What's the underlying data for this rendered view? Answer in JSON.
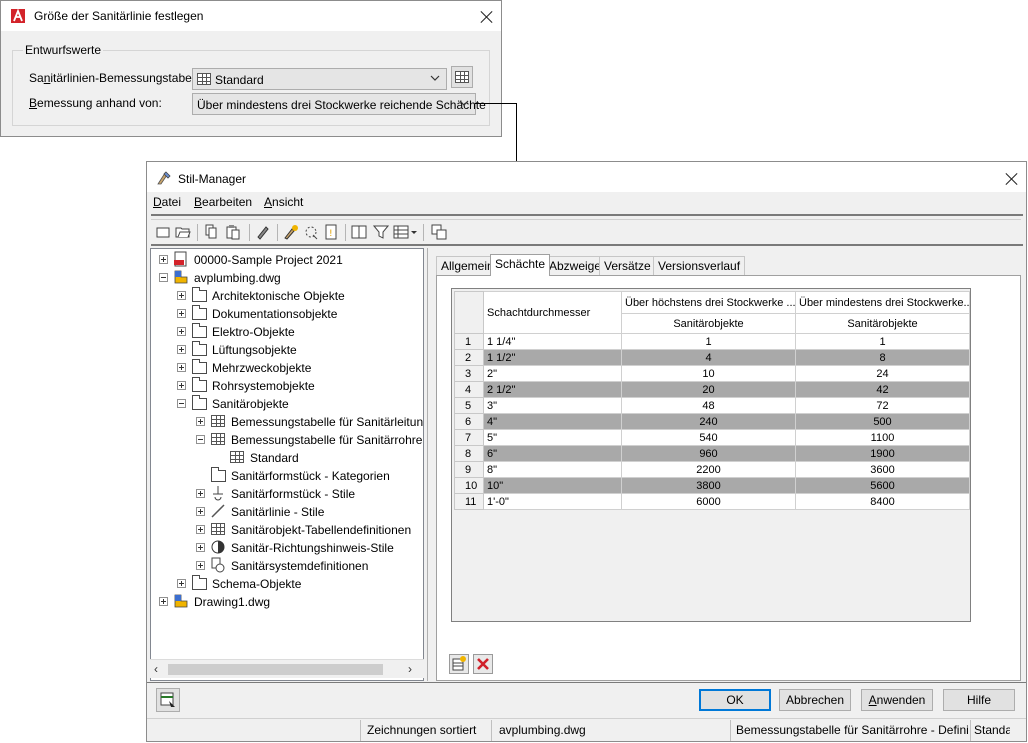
{
  "dialog1": {
    "title": "Größe der Sanitärlinie festlegen",
    "group_label": "Entwurfswerte",
    "table_label_pre": "Sa",
    "table_label_u": "n",
    "table_label_post": "itärlinien-Bemessungstabelle:",
    "table_value": "Standard",
    "basis_label_u": "B",
    "basis_label_post": "emessung anhand von:",
    "basis_value": "Über mindestens drei Stockwerke reichende Schächte"
  },
  "style_manager": {
    "title": "Stil-Manager",
    "menu": [
      {
        "u": "D",
        "rest": "atei"
      },
      {
        "u": "B",
        "rest": "earbeiten"
      },
      {
        "u": "A",
        "pre": "",
        "rest": "nsicht"
      }
    ],
    "tree": [
      {
        "label": "00000-Sample Project 2021",
        "depth": 0,
        "exp": "plus",
        "icon": "project-icon"
      },
      {
        "label": "avplumbing.dwg",
        "depth": 0,
        "exp": "minus",
        "icon": "drawing-icon"
      },
      {
        "label": "Architektonische Objekte",
        "depth": 1,
        "exp": "plus",
        "icon": "folder-icon"
      },
      {
        "label": "Dokumentationsobjekte",
        "depth": 1,
        "exp": "plus",
        "icon": "folder-icon"
      },
      {
        "label": "Elektro-Objekte",
        "depth": 1,
        "exp": "plus",
        "icon": "folder-icon"
      },
      {
        "label": "Lüftungsobjekte",
        "depth": 1,
        "exp": "plus",
        "icon": "folder-icon"
      },
      {
        "label": "Mehrzweckobjekte",
        "depth": 1,
        "exp": "plus",
        "icon": "folder-icon"
      },
      {
        "label": "Rohrsystemobjekte",
        "depth": 1,
        "exp": "plus",
        "icon": "folder-icon"
      },
      {
        "label": "Sanitärobjekte",
        "depth": 1,
        "exp": "minus",
        "icon": "folder-icon"
      },
      {
        "label": "Bemessungstabelle für Sanitärleitungen",
        "depth": 2,
        "exp": "plus",
        "icon": "table-icon"
      },
      {
        "label": "Bemessungstabelle für Sanitärrohre",
        "depth": 2,
        "exp": "minus",
        "icon": "table-icon"
      },
      {
        "label": "Standard",
        "depth": 3,
        "exp": "",
        "icon": "table-icon"
      },
      {
        "label": "Sanitärformstück - Kategorien",
        "depth": 2,
        "exp": "",
        "icon": "folder-icon"
      },
      {
        "label": "Sanitärformstück - Stile",
        "depth": 2,
        "exp": "plus",
        "icon": "fitting-icon"
      },
      {
        "label": "Sanitärlinie - Stile",
        "depth": 2,
        "exp": "plus",
        "icon": "line-icon"
      },
      {
        "label": "Sanitärobjekt-Tabellendefinitionen",
        "depth": 2,
        "exp": "plus",
        "icon": "table-icon"
      },
      {
        "label": "Sanitär-Richtungshinweis-Stile",
        "depth": 2,
        "exp": "plus",
        "icon": "direction-icon"
      },
      {
        "label": "Sanitärsystemdefinitionen",
        "depth": 2,
        "exp": "plus",
        "icon": "system-icon"
      },
      {
        "label": "Schema-Objekte",
        "depth": 1,
        "exp": "plus",
        "icon": "folder-icon"
      },
      {
        "label": "Drawing1.dwg",
        "depth": 0,
        "exp": "plus",
        "icon": "drawing-icon"
      }
    ],
    "tabs": [
      "Allgemein",
      "Schächte",
      "Abzweige",
      "Versätze",
      "Versionsverlauf"
    ],
    "active_tab": 1,
    "table": {
      "col1_header": "Schachtdurchmesser",
      "col2_header": "Über höchstens drei Stockwerke ...",
      "col3_header": "Über mindestens drei Stockwerke...",
      "col2_sub": "Sanitärobjekte",
      "col3_sub": "Sanitärobjekte",
      "rows": [
        [
          "1",
          "1 1/4\"",
          "1",
          "1"
        ],
        [
          "2",
          "1 1/2\"",
          "4",
          "8"
        ],
        [
          "3",
          "2\"",
          "10",
          "24"
        ],
        [
          "4",
          "2 1/2\"",
          "20",
          "42"
        ],
        [
          "5",
          "3\"",
          "48",
          "72"
        ],
        [
          "6",
          "4\"",
          "240",
          "500"
        ],
        [
          "7",
          "5\"",
          "540",
          "1100"
        ],
        [
          "8",
          "6\"",
          "960",
          "1900"
        ],
        [
          "9",
          "8\"",
          "2200",
          "3600"
        ],
        [
          "10",
          "10\"",
          "3800",
          "5600"
        ],
        [
          "11",
          "1'-0\"",
          "6000",
          "8400"
        ]
      ]
    },
    "buttons": {
      "ok": "OK",
      "cancel": "Abbrechen",
      "apply_u": "A",
      "apply_rest": "nwenden",
      "help": "Hilfe"
    },
    "status": {
      "sort": "Zeichnungen sortiert",
      "file": "avplumbing.dwg",
      "path": "Bemessungstabelle für Sanitärrohre - Definit",
      "last": "Standa"
    }
  }
}
